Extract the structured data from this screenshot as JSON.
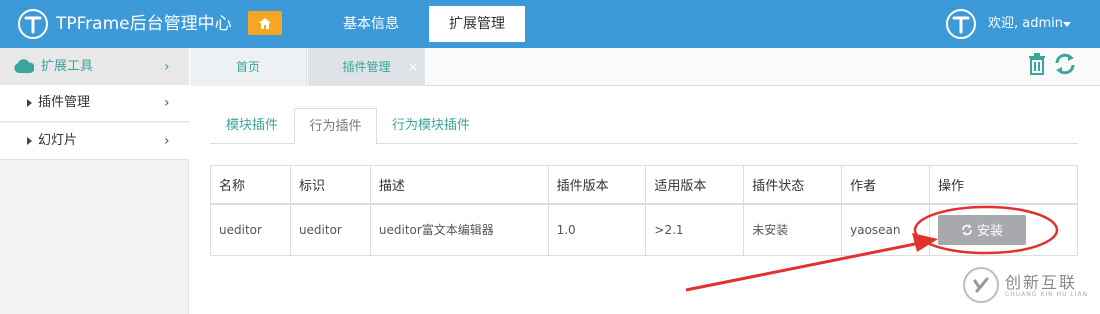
{
  "header": {
    "brand": "TPFrame后台管理中心",
    "nav": [
      "基本信息",
      "扩展管理"
    ],
    "active_nav": "扩展管理",
    "user_greeting": "欢迎, admin",
    "colors": {
      "bar": "#3c9ad8",
      "home_button": "#f5a623",
      "accent": "#3aa59a"
    }
  },
  "sidebar": {
    "group_label": "扩展工具",
    "items": [
      {
        "label": "插件管理"
      },
      {
        "label": "幻灯片"
      }
    ]
  },
  "page_tabs": [
    {
      "label": "首页"
    },
    {
      "label": "插件管理",
      "closable": true
    }
  ],
  "close_glyph": "×",
  "subtabs": [
    "模块插件",
    "行为插件",
    "行为模块插件"
  ],
  "active_subtab": "行为插件",
  "table": {
    "headers": [
      "名称",
      "标识",
      "描述",
      "插件版本",
      "适用版本",
      "插件状态",
      "作者",
      "操作"
    ],
    "rows": [
      [
        "ueditor",
        "ueditor",
        "ueditor富文本编辑器",
        "1.0",
        ">2.1",
        "未安装",
        "yaosean"
      ]
    ],
    "action_label": "安装"
  },
  "watermark": {
    "title": "创新互联",
    "subtitle": "CHUANG XIN HU LIAN"
  },
  "icons": [
    "home-icon",
    "cloud-icon",
    "trash-icon",
    "refresh-icon",
    "chevron-right-icon",
    "caret-down-icon"
  ]
}
